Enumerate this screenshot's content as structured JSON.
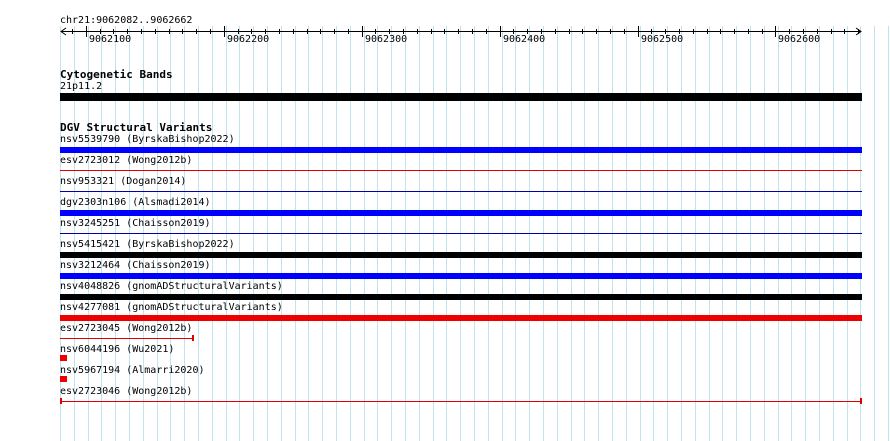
{
  "region": "chr21:9062082..9062662",
  "ruler": {
    "ticks": [
      "9062100",
      "9062200",
      "9062300",
      "9062400",
      "9062500",
      "9062600"
    ]
  },
  "cytoband": {
    "title": "Cytogenetic Bands",
    "band": "21p11.2"
  },
  "dgv": {
    "title": "DGV Structural Variants",
    "variants": [
      {
        "label": "nsv5539790 (ByrskaBishop2022)",
        "color": "#0000ff",
        "style": "thick",
        "start": 9062082,
        "end": 9062662
      },
      {
        "label": "esv2723012 (Wong2012b)",
        "color": "#e00000",
        "style": "thin",
        "start": 9062082,
        "end": 9062662
      },
      {
        "label": "nsv953321 (Dogan2014)",
        "color": "#0000aa",
        "style": "thin",
        "start": 9062082,
        "end": 9062662
      },
      {
        "label": "dgv2303n106 (Alsmadi2014)",
        "color": "#0000ff",
        "style": "thick",
        "start": 9062082,
        "end": 9062662
      },
      {
        "label": "nsv3245251 (Chaisson2019)",
        "color": "#0000aa",
        "style": "thin",
        "start": 9062082,
        "end": 9062662
      },
      {
        "label": "nsv5415421 (ByrskaBishop2022)",
        "color": "#000000",
        "style": "thick",
        "start": 9062082,
        "end": 9062662
      },
      {
        "label": "nsv3212464 (Chaisson2019)",
        "color": "#0000ff",
        "style": "thick",
        "start": 9062082,
        "end": 9062662
      },
      {
        "label": "nsv4048826 (gnomADStructuralVariants)",
        "color": "#000000",
        "style": "thick",
        "start": 9062082,
        "end": 9062662
      },
      {
        "label": "nsv4277081 (gnomADStructuralVariants)",
        "color": "#ee0000",
        "style": "thick",
        "start": 9062082,
        "end": 9062662
      },
      {
        "label": "esv2723045 (Wong2012b)",
        "color": "#e00000",
        "style": "thin-end",
        "start": 9062082,
        "end": 9062178
      },
      {
        "label": "nsv6044196 (Wu2021)",
        "color": "#ee0000",
        "style": "block",
        "start": 9062082,
        "end": 9062086
      },
      {
        "label": "nsv5967194 (Almarri2020)",
        "color": "#ee0000",
        "style": "block",
        "start": 9062082,
        "end": 9062086
      },
      {
        "label": "esv2723046 (Wong2012b)",
        "color": "#e00000",
        "style": "thin-both",
        "start": 9062082,
        "end": 9062662
      }
    ]
  }
}
